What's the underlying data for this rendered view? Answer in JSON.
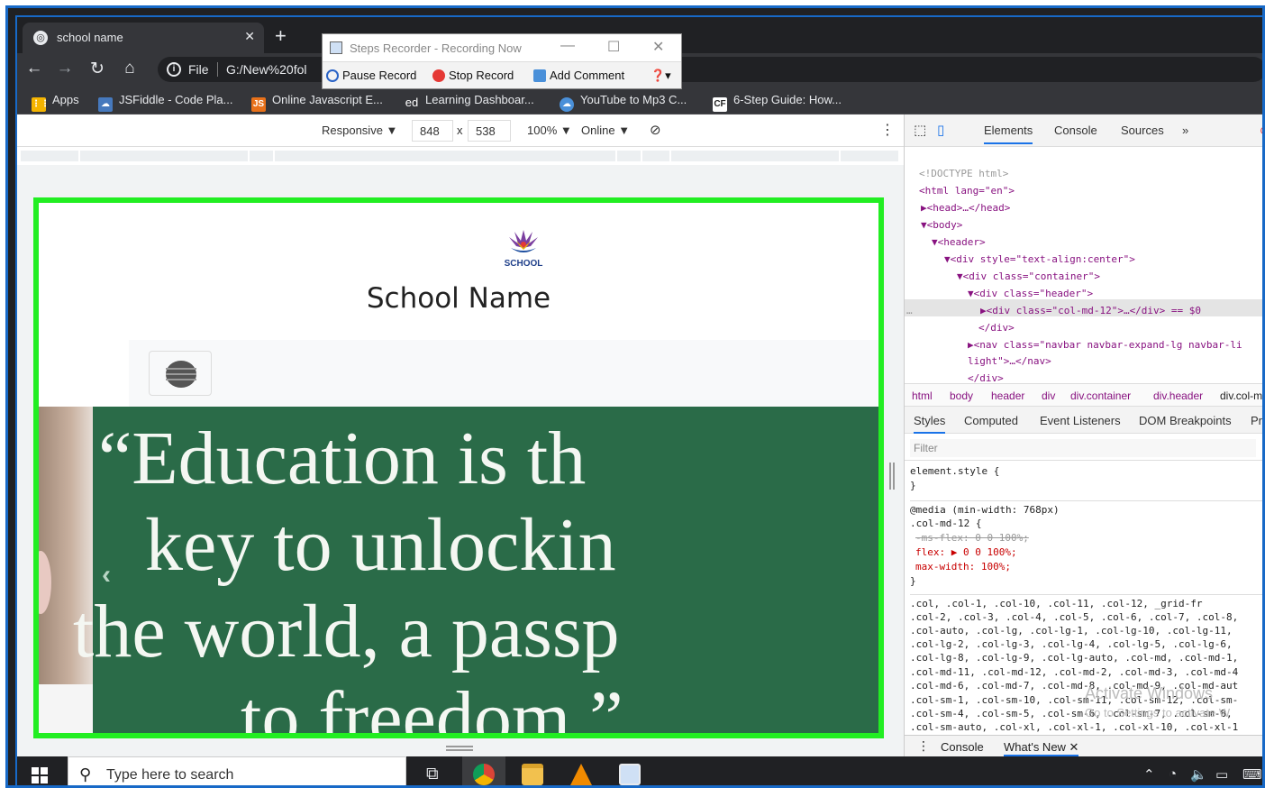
{
  "browser": {
    "tab_title": "school name",
    "close_tab": "✕",
    "new_tab": "+",
    "address_scheme": "File",
    "address_url": "G:/New%20fol"
  },
  "bookmarks": [
    {
      "label": "Apps",
      "icon": "apps-grid-icon",
      "color": "#f4b400"
    },
    {
      "label": "JSFiddle - Code Pla...",
      "icon": "jsfiddle-icon",
      "color": "#4679bd"
    },
    {
      "label": "Online Javascript E...",
      "icon": "js-icon",
      "color": "#e8711a"
    },
    {
      "label": "Learning Dashboar...",
      "icon": "ed-icon",
      "color": "#35363a"
    },
    {
      "label": "YouTube to Mp3 C...",
      "icon": "cloud-icon",
      "color": "#4a90d9"
    },
    {
      "label": "6-Step Guide: How...",
      "icon": "cf-icon",
      "color": "#ffffff"
    }
  ],
  "steps_recorder": {
    "title": "Steps Recorder - Recording Now",
    "pause": "Pause Record",
    "stop": "Stop Record",
    "comment": "Add Comment"
  },
  "device_toolbar": {
    "mode": "Responsive ▼",
    "width": "848",
    "times": "x",
    "height": "538",
    "zoom": "100% ▼",
    "network": "Online ▼"
  },
  "page": {
    "logo_text": "SCHOOL",
    "school_name": "School Name",
    "quote_lines": [
      "“Education is th",
      "key to unlockin",
      "the world, a passp",
      "to freedom.”"
    ],
    "prev_arrow": "‹"
  },
  "devtools": {
    "tabs": [
      "Elements",
      "Console",
      "Sources",
      "»"
    ],
    "dom": [
      {
        "indent": 0,
        "text": "<!DOCTYPE html>",
        "kind": "gray"
      },
      {
        "indent": 0,
        "text": "<html lang=\"en\">",
        "kind": "tag"
      },
      {
        "indent": 1,
        "text": "▶<head>…</head>",
        "kind": "tag"
      },
      {
        "indent": 1,
        "text": "▼<body>",
        "kind": "tag"
      },
      {
        "indent": 2,
        "text": "▼<header>",
        "kind": "tag"
      },
      {
        "indent": 3,
        "text": "▼<div style=\"text-align:center\">",
        "kind": "tag"
      },
      {
        "indent": 4,
        "text": "▼<div class=\"container\">",
        "kind": "tag"
      },
      {
        "indent": 5,
        "text": "▼<div class=\"header\">",
        "kind": "tag"
      },
      {
        "indent": 6,
        "text": "▶<div class=\"col-md-12\">…</div> == $0",
        "kind": "tag"
      },
      {
        "indent": 5,
        "text": "</div>",
        "kind": "tag"
      },
      {
        "indent": 5,
        "text": "▶<nav class=\"navbar navbar-expand-lg navbar-li",
        "kind": "tag"
      },
      {
        "indent": 4,
        "text": "light\">…</nav>",
        "kind": "tag"
      },
      {
        "indent": 4,
        "text": "</div>",
        "kind": "tag"
      }
    ],
    "breadcrumbs": [
      "html",
      "body",
      "header",
      "div",
      "div.container",
      "div.header",
      "div.col-m"
    ],
    "subtabs": [
      "Styles",
      "Computed",
      "Event Listeners",
      "DOM Breakpoints",
      "Pro"
    ],
    "filter_placeholder": "Filter",
    "styles": [
      {
        "text": "element.style {",
        "kind": "plain"
      },
      {
        "text": "}",
        "kind": "plain"
      },
      {
        "text": "@media (min-width: 768px)",
        "kind": "plain"
      },
      {
        "text": ".col-md-12 {",
        "kind": "plain"
      },
      {
        "text": "  -ms-flex: 0 0 100%;",
        "kind": "strike"
      },
      {
        "text": "  flex: ▶ 0 0 100%;",
        "kind": "prop"
      },
      {
        "text": "  max-width: 100%;",
        "kind": "prop"
      },
      {
        "text": "}",
        "kind": "plain"
      },
      {
        "text": ".col, .col-1, .col-10, .col-11, .col-12,      _grid-fr",
        "kind": "plain"
      },
      {
        "text": ".col-2, .col-3, .col-4, .col-5, .col-6, .col-7, .col-8,",
        "kind": "plain"
      },
      {
        "text": ".col-auto, .col-lg, .col-lg-1, .col-lg-10, .col-lg-11,",
        "kind": "plain"
      },
      {
        "text": ".col-lg-2, .col-lg-3, .col-lg-4, .col-lg-5, .col-lg-6,",
        "kind": "plain"
      },
      {
        "text": ".col-lg-8, .col-lg-9, .col-lg-auto, .col-md, .col-md-1,",
        "kind": "plain"
      },
      {
        "text": ".col-md-11, .col-md-12, .col-md-2, .col-md-3, .col-md-4",
        "kind": "plain"
      },
      {
        "text": ".col-md-6, .col-md-7, .col-md-8, .col-md-9, .col-md-aut",
        "kind": "plain"
      },
      {
        "text": ".col-sm-1, .col-sm-10, .col-sm-11, .col-sm-12, .col-sm-",
        "kind": "plain"
      },
      {
        "text": ".col-sm-4, .col-sm-5, .col-sm-6, .col-sm-7, .col-sm-8,",
        "kind": "plain"
      },
      {
        "text": ".col-sm-auto, .col-xl, .col-xl-1, .col-xl-10, .col-xl-1",
        "kind": "plain"
      }
    ],
    "watermark": "Activate Windows",
    "watermark_sub": "Go to Settings to activate W",
    "drawer_console": "Console",
    "drawer_whatsnew": "What's New ✕"
  },
  "taskbar": {
    "search_placeholder": "Type here to search"
  }
}
